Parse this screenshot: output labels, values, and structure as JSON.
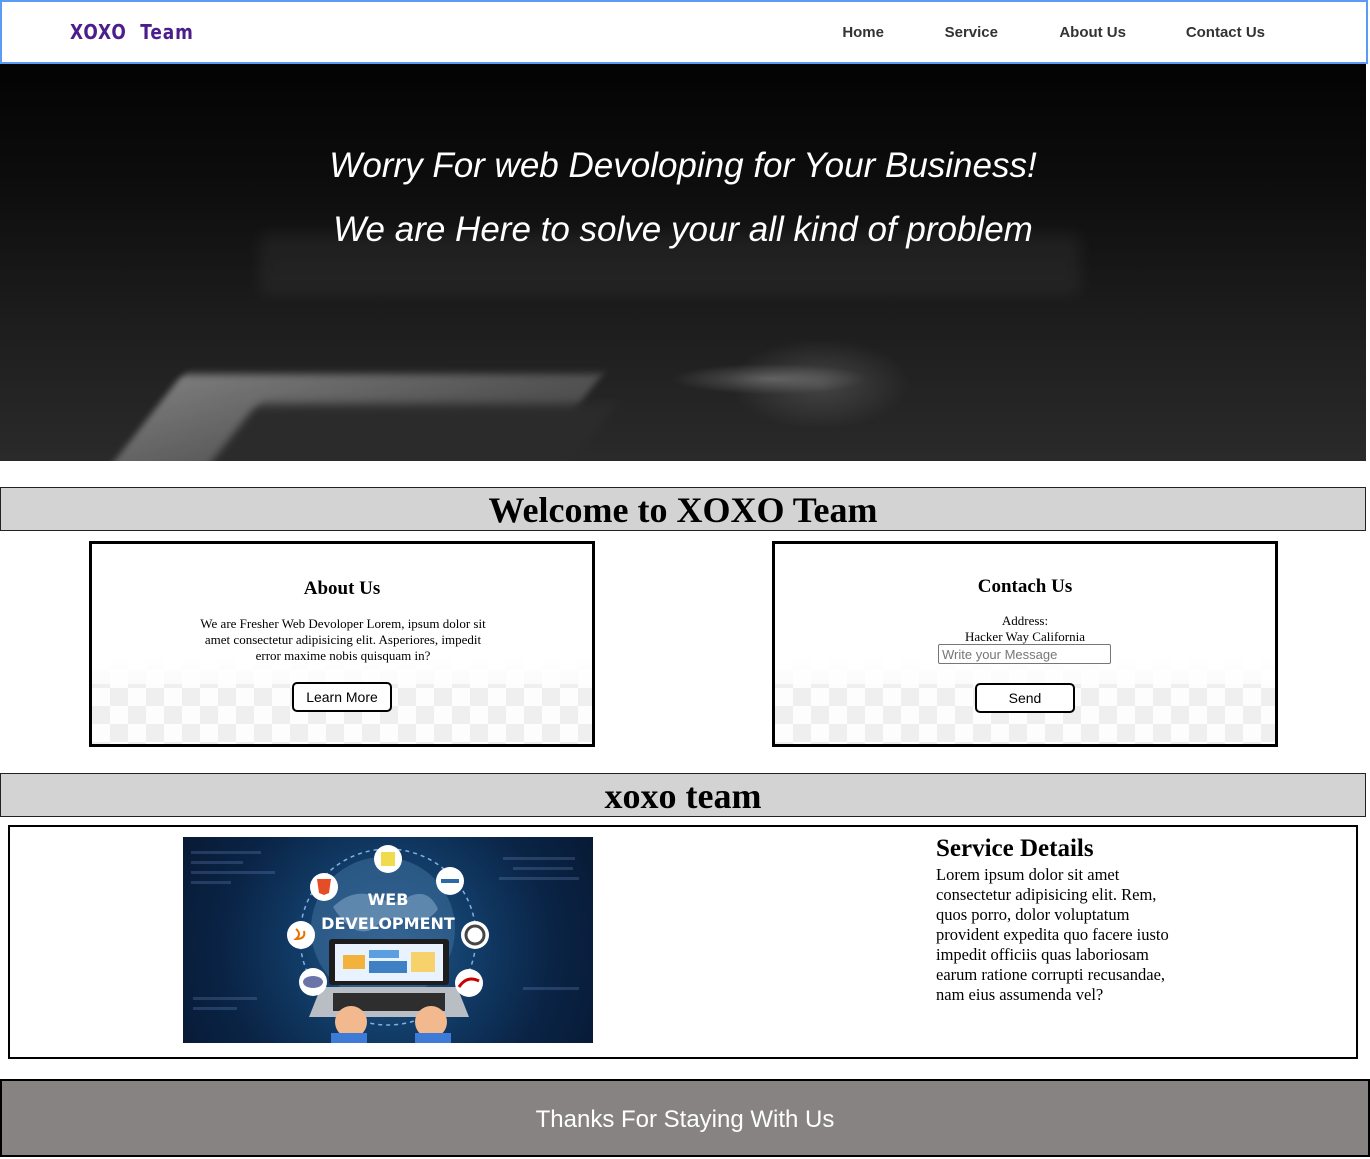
{
  "navbar": {
    "brand": "XOXO  Team",
    "links": [
      {
        "label": "Home"
      },
      {
        "label": "Service"
      },
      {
        "label": "About Us"
      },
      {
        "label": "Contact Us"
      }
    ]
  },
  "hero": {
    "line1": "Worry For web Devoloping for Your Business!",
    "line2": "We are Here to solve your all kind of problem"
  },
  "welcome": {
    "heading": "Welcome to XOXO Team"
  },
  "about_card": {
    "title": "About Us",
    "text": "We are Fresher Web Devoloper Lorem, ipsum dolor sit amet consectetur adipisicing elit. Asperiores, impedit error maxime nobis quisquam in?",
    "button_label": "Learn More"
  },
  "contact_card": {
    "title": "Contach Us",
    "address_label": "Address:",
    "address_value": "Hacker Way California",
    "message_placeholder": "Write your Message",
    "button_label": "Send"
  },
  "team": {
    "heading": "xoxo team"
  },
  "service": {
    "image_text_line1": "WEB",
    "image_text_line2": "DEVELOPMENT",
    "title": "Service Details",
    "text": "Lorem ipsum dolor sit amet consectetur adipisicing elit. Rem, quos porro, dolor voluptatum provident expedita quo facere iusto impedit officiis quas laboriosam earum ratione corrupti recusandae, nam eius assumenda vel?"
  },
  "footer": {
    "text": "Thanks For Staying With Us"
  },
  "colors": {
    "brand": "#4b1e8c",
    "nav_border": "#5b9bf5",
    "section_bar": "#d3d3d3",
    "footer_bg": "#878383"
  }
}
